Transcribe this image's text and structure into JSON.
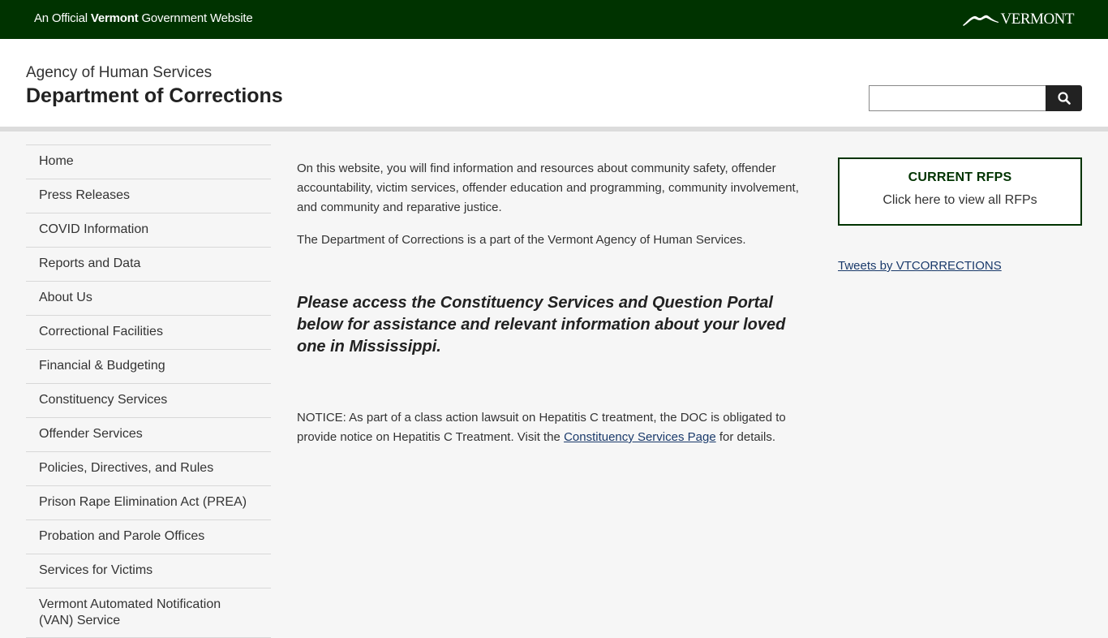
{
  "topbar": {
    "official_prefix": "An Official ",
    "official_state": "Vermont",
    "official_suffix": " Government Website",
    "logo_text": "VERMONT",
    "bg_color": "#003300"
  },
  "header": {
    "agency": "Agency of Human Services",
    "department": "Department of Corrections",
    "search_placeholder": ""
  },
  "sidebar": {
    "items": [
      {
        "label": "Home"
      },
      {
        "label": "Press Releases"
      },
      {
        "label": "COVID Information"
      },
      {
        "label": "Reports and Data"
      },
      {
        "label": "About Us"
      },
      {
        "label": "Correctional Facilities"
      },
      {
        "label": "Financial & Budgeting"
      },
      {
        "label": "Constituency Services"
      },
      {
        "label": "Offender Services"
      },
      {
        "label": "Policies, Directives, and Rules"
      },
      {
        "label": "Prison Rape Elimination Act (PREA)"
      },
      {
        "label": "Probation and Parole Offices"
      },
      {
        "label": "Services for Victims"
      },
      {
        "label": "Vermont Automated Notification (VAN) Service"
      }
    ]
  },
  "main": {
    "intro": "On this website, you will find information and resources about community safety, offender accountability, victim services, offender education and programming, community involvement, and community and reparative justice.",
    "part_of": "The Department of Corrections is a part of the Vermont Agency of Human Services.",
    "callout": "Please access the Constituency Services and Question Portal below for assistance and relevant information about your loved one in Mississippi.",
    "notice_before": "NOTICE: As part of a class action lawsuit on Hepatitis C treatment, the DOC is obligated to provide notice on Hepatitis C Treatment. Visit the ",
    "notice_link": "Constituency Services Page",
    "notice_after": " for details."
  },
  "aside": {
    "rfp_title": "CURRENT RFPS",
    "rfp_link": "Click here to view all RFPs",
    "tweets_link": "Tweets by VTCORRECTIONS"
  }
}
